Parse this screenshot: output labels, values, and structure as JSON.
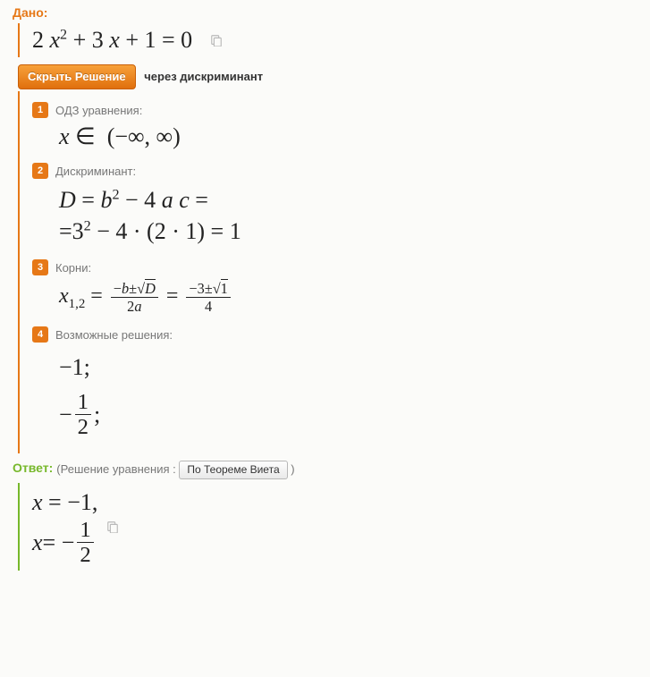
{
  "given": {
    "heading": "Дано:",
    "equation_html": "2 <i>x</i><sup>2</sup> + 3 <i>x</i> + 1 = 0"
  },
  "hide_button": "Скрыть Решение",
  "subtitle": "через дискриминант",
  "steps": [
    {
      "num": "1",
      "label": "ОДЗ уравнения:",
      "math_html": "<i>x</i> ∈&nbsp; (−∞, ∞)"
    },
    {
      "num": "2",
      "label": "Дискриминант:",
      "math_html": "<span class=\"row-line\"><i>D</i> = <i>b</i><sup>2</sup> − 4 <i>a c</i> =</span><span class=\"row-line\">=3<sup>2</sup> − 4 · (2 · 1) = 1</span>"
    },
    {
      "num": "3",
      "label": "Корни:",
      "math_html": "<i>x</i><sub>1,2</sub> = <span class=\"frac\"><span class=\"num\">−<i>b</i>±√<span style=\"border-top:1.2px solid #222;\"><i>D</i></span></span><span class=\"den\">2<i>a</i></span></span> = <span class=\"frac\"><span class=\"num\">−3±√<span style=\"border-top:1.2px solid #222;\">1</span></span><span class=\"den\">4</span></span>"
    },
    {
      "num": "4",
      "label": "Возможные решения:",
      "math_html": "<div class=\"solutions\"><span class=\"row-line\">−1;</span><span class=\"row-line\" style=\"display:flex;align-items:center;\">−<span class=\"frac frac-big\"><span class=\"num\">1</span><span class=\"den\">2</span></span>;</span></div>"
    }
  ],
  "answer": {
    "heading": "Ответ:",
    "note_prefix": "(Решение уравнения :",
    "vieta_button": "По Теореме Виета",
    "note_suffix": ")",
    "math_html": "<span class=\"row-line\"><i>x</i> = −1,</span><span class=\"row-line\" style=\"display:flex;align-items:center;\"><i>x</i> = −<span class=\"frac frac-big\"><span class=\"num\">1</span><span class=\"den\">2</span></span></span>"
  },
  "icons": {
    "copy": "copy"
  },
  "chart_data": {
    "type": "equation-solution",
    "equation": "2x^2 + 3x + 1 = 0",
    "coefficients": {
      "a": 2,
      "b": 3,
      "c": 1
    },
    "domain": "(-∞, ∞)",
    "discriminant_formula": "D = b^2 - 4ac = 3^2 - 4*(2*1) = 1",
    "discriminant": 1,
    "roots_formula": "x_{1,2} = (-b ± √D) / (2a) = (-3 ± √1) / 4",
    "roots": [
      -1,
      -0.5
    ],
    "answer": [
      "x = -1",
      "x = -1/2"
    ]
  }
}
